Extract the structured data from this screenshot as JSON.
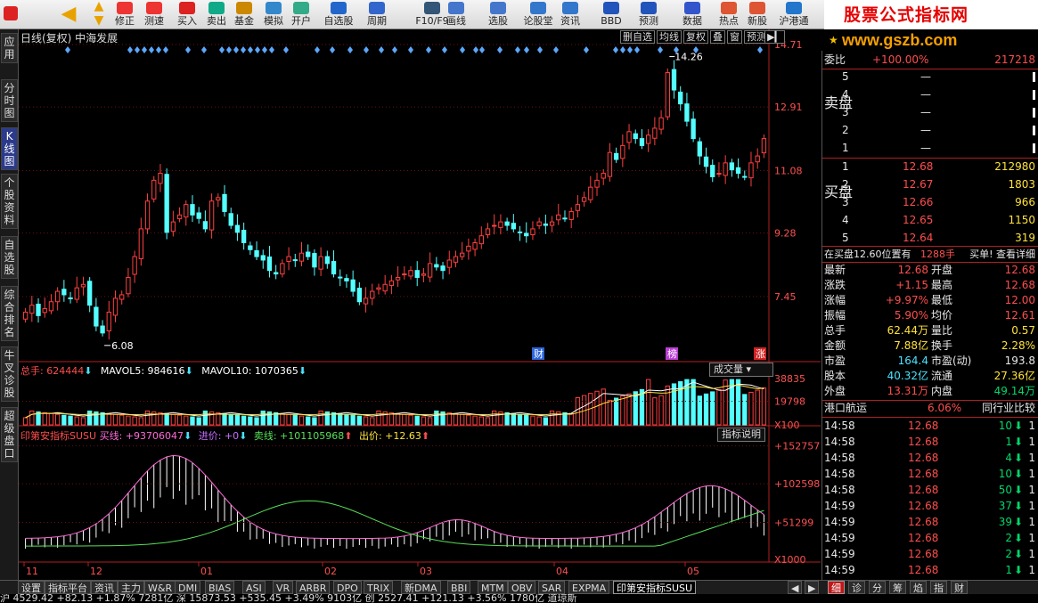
{
  "toolbar": {
    "buttons": [
      {
        "label": "修正",
        "icon": "edit-icon"
      },
      {
        "label": "测速",
        "icon": "speed-icon"
      },
      {
        "label": "买入",
        "icon": "buy-icon"
      },
      {
        "label": "卖出",
        "icon": "sell-icon"
      },
      {
        "label": "基金",
        "icon": "fund-icon"
      },
      {
        "label": "模拟",
        "icon": "simulate-icon"
      },
      {
        "label": "开户",
        "icon": "account-icon"
      },
      {
        "label": "自选股",
        "icon": "watchlist-icon"
      },
      {
        "label": "周期",
        "icon": "period-icon"
      },
      {
        "label": "F10/F9",
        "icon": "f10-icon"
      },
      {
        "label": "画线",
        "icon": "draw-icon"
      },
      {
        "label": "选股",
        "icon": "select-icon"
      },
      {
        "label": "论股堂",
        "icon": "forum-icon"
      },
      {
        "label": "资讯",
        "icon": "news-icon"
      },
      {
        "label": "BBD",
        "icon": "bbd-icon"
      },
      {
        "label": "预测",
        "icon": "forecast-icon"
      },
      {
        "label": "数据",
        "icon": "data-icon"
      },
      {
        "label": "热点",
        "icon": "hot-icon"
      },
      {
        "label": "新股",
        "icon": "ipo-icon"
      },
      {
        "label": "沪港通",
        "icon": "hk-connect-icon"
      }
    ],
    "brand_name": "股票公式指标网",
    "brand_url": "www.gszb.com"
  },
  "left_sidebar": [
    {
      "label": "应用"
    },
    {
      "label": "分时图"
    },
    {
      "label": "K线图"
    },
    {
      "label": "个股资料"
    },
    {
      "label": "自选股"
    },
    {
      "label": "综合排名"
    },
    {
      "label": "牛叉诊股"
    },
    {
      "label": "超级盘口"
    }
  ],
  "chart_header": {
    "title": "日线(复权)  中海发展",
    "controls": [
      "删自选",
      "均线",
      "复权",
      "叠",
      "窗",
      "预测"
    ]
  },
  "chart_data": [
    {
      "type": "candlestick",
      "title": "日线(复权) 中海发展",
      "y_ticks": [
        "14.71",
        "12.91",
        "11.08",
        "9.28",
        "7.45"
      ],
      "ylim": [
        5.6,
        14.71
      ],
      "x_ticks": [
        "11",
        "12",
        "01",
        "02",
        "03",
        "04",
        "05"
      ],
      "annotations": [
        {
          "text": "14.26",
          "note": "high"
        },
        {
          "text": "6.08",
          "note": "low"
        }
      ],
      "markers": [
        "财",
        "榜",
        "涨"
      ],
      "closes": [
        7.0,
        7.2,
        6.9,
        7.1,
        7.3,
        7.6,
        7.5,
        7.4,
        7.7,
        7.8,
        7.2,
        6.6,
        6.4,
        7.0,
        7.4,
        7.5,
        8.0,
        8.6,
        9.4,
        10.2,
        10.8,
        11.0,
        9.3,
        9.6,
        9.8,
        10.1,
        9.8,
        9.7,
        9.4,
        10.2,
        10.3,
        9.9,
        9.5,
        9.3,
        9.0,
        8.8,
        8.6,
        8.5,
        8.2,
        8.1,
        8.4,
        8.6,
        8.5,
        8.7,
        8.6,
        8.3,
        8.6,
        8.4,
        8.1,
        8.0,
        7.9,
        7.6,
        7.3,
        7.4,
        7.6,
        7.7,
        7.8,
        7.9,
        8.0,
        8.1,
        8.2,
        8.0,
        8.1,
        8.4,
        8.3,
        8.2,
        8.5,
        8.6,
        8.7,
        8.9,
        9.0,
        9.2,
        9.4,
        9.5,
        9.6,
        9.5,
        9.4,
        9.3,
        9.2,
        9.4,
        9.6,
        9.5,
        9.6,
        9.8,
        9.7,
        9.9,
        10.1,
        10.3,
        10.6,
        10.8,
        11.0,
        11.6,
        11.4,
        11.8,
        12.2,
        12.0,
        11.8,
        12.1,
        12.3,
        12.6,
        13.9,
        13.4,
        13.0,
        12.5,
        12.0,
        11.5,
        11.2,
        10.9,
        11.0,
        11.3,
        11.1,
        11.0,
        10.9,
        11.3,
        11.5,
        12.0
      ]
    },
    {
      "type": "bar",
      "title": "总手",
      "series_label": "总手: 624444",
      "ma5_label": "MAVOL5: 984616",
      "ma10_label": "MAVOL10: 1070365",
      "y_ticks": [
        "38835",
        "19798",
        "X100"
      ]
    },
    {
      "type": "line",
      "title": "印第安指标SUSU",
      "buy_label": "买线: +93706047",
      "entry_label": "进价: +0",
      "sell_label": "卖线: +101105968",
      "exit_label": "出价: +12.63",
      "y_ticks": [
        "+152757",
        "+102598",
        "+51299",
        "X1000"
      ]
    }
  ],
  "vol_button": "成交量",
  "ind_button": "指标说明",
  "right_panel": {
    "weibi_label": "委比",
    "weibi_value": "+100.00%",
    "weicha_value": "217218",
    "sell_side_label": "卖盘",
    "sell_levels": [
      {
        "level": "5",
        "price": "—",
        "vol": ""
      },
      {
        "level": "4",
        "price": "—",
        "vol": ""
      },
      {
        "level": "3",
        "price": "—",
        "vol": ""
      },
      {
        "level": "2",
        "price": "—",
        "vol": ""
      },
      {
        "level": "1",
        "price": "—",
        "vol": ""
      }
    ],
    "buy_side_label": "买盘",
    "buy_levels": [
      {
        "level": "1",
        "price": "12.68",
        "vol": "212980"
      },
      {
        "level": "2",
        "price": "12.67",
        "vol": "1803"
      },
      {
        "level": "3",
        "price": "12.66",
        "vol": "966"
      },
      {
        "level": "4",
        "price": "12.65",
        "vol": "1150"
      },
      {
        "level": "5",
        "price": "12.64",
        "vol": "319"
      }
    ],
    "queue_text": "在买盘12.60位置有",
    "queue_count": "1288手",
    "queue_actions": "买单! 查看详细",
    "quote_rows": [
      {
        "k1": "最新",
        "v1": "12.68",
        "k2": "开盘",
        "v2": "12.68"
      },
      {
        "k1": "涨跌",
        "v1": "+1.15",
        "k2": "最高",
        "v2": "12.68"
      },
      {
        "k1": "涨幅",
        "v1": "+9.97%",
        "k2": "最低",
        "v2": "12.00"
      },
      {
        "k1": "振幅",
        "v1": "5.90%",
        "k2": "均价",
        "v2": "12.61"
      },
      {
        "k1": "总手",
        "v1": "62.44万",
        "k2": "量比",
        "v2": "0.57"
      },
      {
        "k1": "金额",
        "v1": "7.88亿",
        "k2": "换手",
        "v2": "2.28%"
      },
      {
        "k1": "市盈",
        "v1": "164.4",
        "k2": "市盈(动)",
        "v2": "193.8"
      },
      {
        "k1": "股本",
        "v1": "40.32亿",
        "k2": "流通",
        "v2": "27.36亿"
      },
      {
        "k1": "外盘",
        "v1": "13.31万",
        "k2": "内盘",
        "v2": "49.14万"
      }
    ],
    "sector_name": "港口航运",
    "sector_change": "6.06%",
    "sector_button": "同行业比较",
    "ticks": [
      {
        "time": "14:58",
        "price": "12.68",
        "vol": "10"
      },
      {
        "time": "14:58",
        "price": "12.68",
        "vol": "1"
      },
      {
        "time": "14:58",
        "price": "12.68",
        "vol": "4"
      },
      {
        "time": "14:58",
        "price": "12.68",
        "vol": "10"
      },
      {
        "time": "14:58",
        "price": "12.68",
        "vol": "50"
      },
      {
        "time": "14:59",
        "price": "12.68",
        "vol": "37"
      },
      {
        "time": "14:59",
        "price": "12.68",
        "vol": "39"
      },
      {
        "time": "14:59",
        "price": "12.68",
        "vol": "2"
      },
      {
        "time": "14:59",
        "price": "12.68",
        "vol": "2"
      },
      {
        "time": "14:59",
        "price": "12.68",
        "vol": "1"
      }
    ],
    "tick_suffix": "1"
  },
  "bottom_tabs": [
    "设置",
    "指标平台",
    "资讯",
    "主力",
    "W&R",
    "DMI",
    "BIAS",
    "ASI",
    "VR",
    "ARBR",
    "DPO",
    "TRIX",
    "新DMA",
    "BBI",
    "MTM",
    "OBV",
    "SAR",
    "EXPMA",
    "印第安指标SUSU"
  ],
  "right_tabs": [
    "细",
    "诊",
    "分",
    "筹",
    "焰",
    "指",
    "财"
  ],
  "status_text": "沪 4529.42  +82.13 +1.87%   7281亿 深 15873.53 +535.45 +3.49%   9103亿 创 2527.41 +121.13 +3.56%   1780亿 道琼斯"
}
